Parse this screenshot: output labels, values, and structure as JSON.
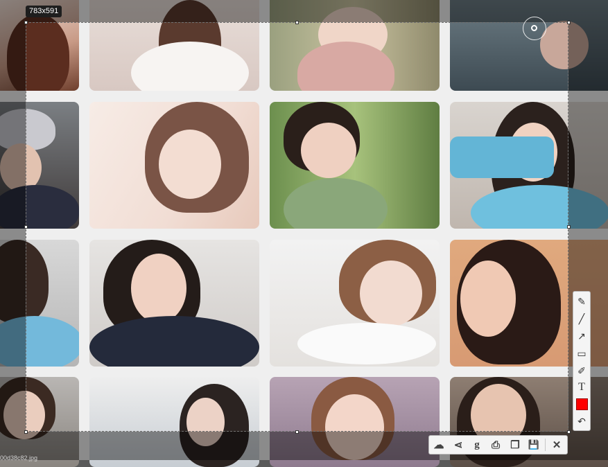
{
  "capture": {
    "size_label": "783x591",
    "stray_text": "00d38c82.jpg"
  },
  "colors": {
    "accent_red": "#ff0000",
    "panel_bg": "#f4f4f4",
    "label_bg": "#1e1e1e"
  },
  "toolbar": {
    "tools": [
      {
        "name": "pencil-brush",
        "glyph": "✎"
      },
      {
        "name": "line",
        "glyph": "╱"
      },
      {
        "name": "arrow",
        "glyph": "↗"
      },
      {
        "name": "rectangle",
        "glyph": "▭"
      },
      {
        "name": "highlighter",
        "glyph": "✐"
      },
      {
        "name": "text",
        "glyph": "T"
      },
      {
        "name": "color",
        "glyph": ""
      },
      {
        "name": "undo",
        "glyph": "↶"
      }
    ],
    "actions": [
      {
        "name": "upload-cloud",
        "glyph": "☁"
      },
      {
        "name": "share",
        "glyph": "⋖"
      },
      {
        "name": "search-google",
        "glyph": "g"
      },
      {
        "name": "print",
        "glyph": "⎙"
      },
      {
        "name": "copy",
        "glyph": "❐"
      },
      {
        "name": "save",
        "glyph": "💾"
      },
      {
        "name": "close",
        "glyph": "✕"
      }
    ]
  }
}
